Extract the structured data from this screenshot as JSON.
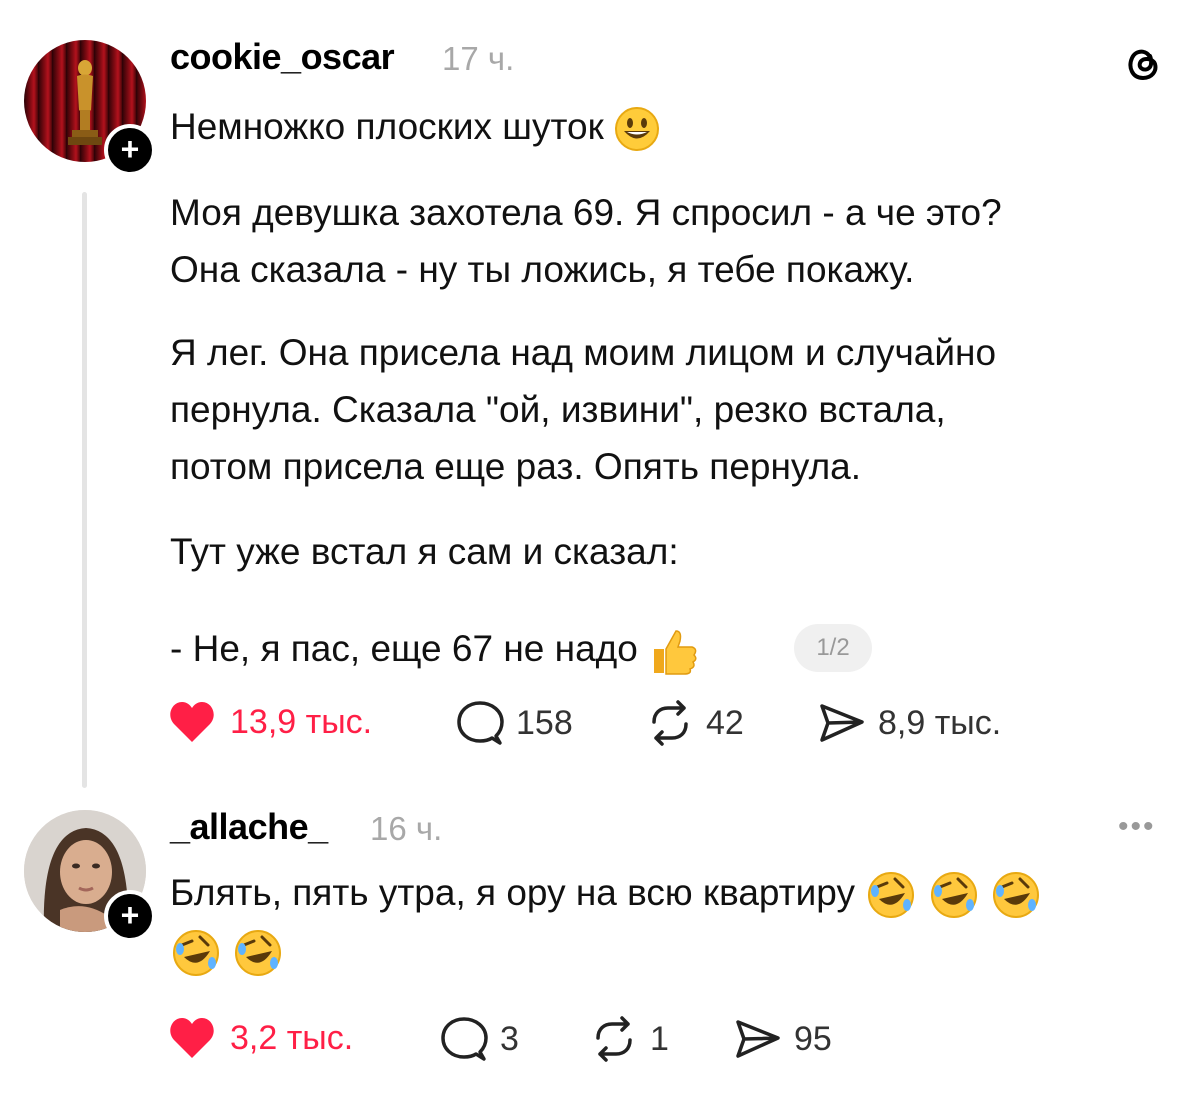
{
  "post": {
    "username": "cookie_oscar",
    "time": "17 ч.",
    "heading": "Немножко плоских шуток",
    "paragraphs": [
      "Моя девушка захотела 69. Я спросил - а че это?",
      "Она сказала - ну ты ложись, я тебе покажу.",
      "Я лег. Она присела над моим лицом и случайно",
      "пернула. Сказала \"ой, извини\", резко встала,",
      "потом присела еще раз. Опять пернула.",
      "Тут уже встал я сам и сказал:",
      "- Не, я пас, еще 67 не надо"
    ],
    "pager": "1/2",
    "likes": "13,9 тыс.",
    "comments": "158",
    "reposts": "42",
    "shares": "8,9 тыс.",
    "like_color": "#ff1f46"
  },
  "reply": {
    "username": "_allache_",
    "time": "16 ч.",
    "text": "Блять, пять утра, я ору на всю квартиру",
    "more": "•••",
    "likes": "3,2 тыс.",
    "comments": "3",
    "reposts": "1",
    "shares": "95"
  },
  "icons": {
    "app_logo": "threads-icon",
    "heading_emoji": "grinning-face-icon",
    "thumbs_emoji": "thumbs-up-icon",
    "laugh_emoji": "rolling-on-floor-laughing-icon"
  }
}
